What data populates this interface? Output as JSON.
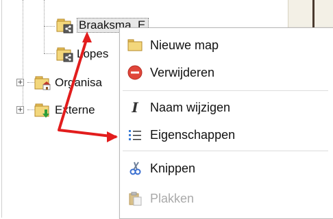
{
  "tree": {
    "items": [
      {
        "label": "Braaksma, E"
      },
      {
        "label": "Lopes"
      },
      {
        "label": "Organisa"
      },
      {
        "label": "Externe"
      }
    ],
    "expander_symbol": "+"
  },
  "context_menu": {
    "items": [
      {
        "label": "Nieuwe map",
        "icon": "folder-icon"
      },
      {
        "label": "Verwijderen",
        "icon": "delete-icon"
      },
      {
        "label": "Naam wijzigen",
        "icon": "rename-icon"
      },
      {
        "label": "Eigenschappen",
        "icon": "properties-icon"
      },
      {
        "label": "Knippen",
        "icon": "scissors-icon"
      },
      {
        "label": "Plakken",
        "icon": "paste-icon",
        "disabled": true
      }
    ]
  },
  "colors": {
    "arrow": "#e21d1d",
    "menu_border": "#b8b8b8",
    "selected_bg": "#e8e8e8",
    "disabled_text": "#aaaaaa"
  }
}
